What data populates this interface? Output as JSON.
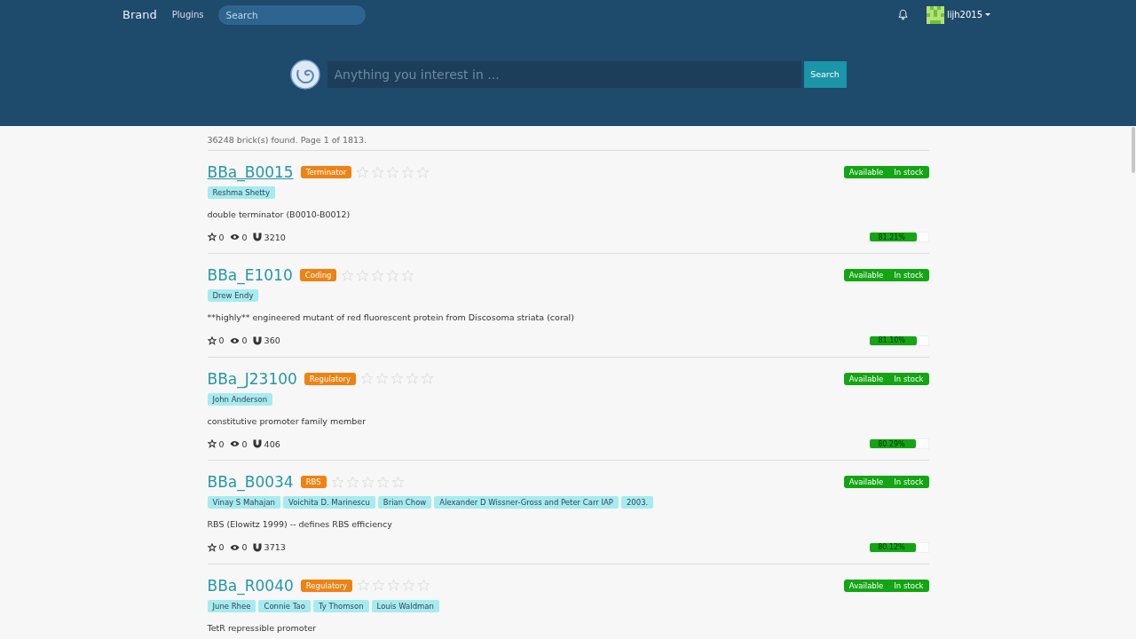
{
  "navbar": {
    "brand": "Brand",
    "links": [
      "Plugins"
    ],
    "search": {
      "placeholder": "Search"
    },
    "user": {
      "name": "lijh2015"
    }
  },
  "hero": {
    "search": {
      "placeholder": "Anything you interest in ..."
    },
    "button": "Search"
  },
  "summary": "36248 brick(s) found. Page 1 of 1813.",
  "bricks": [
    {
      "name": "BBa_B0015",
      "hovered": true,
      "type": "Terminator",
      "stars": 0,
      "authors": [
        "Reshma Shetty"
      ],
      "description": "double terminator (B0010-B0012)",
      "favorites": "0",
      "views": "0",
      "uses": "3210",
      "status": "Available",
      "stock": "In stock",
      "level": 0.81,
      "percent": "81.21%"
    },
    {
      "name": "BBa_E1010",
      "hovered": false,
      "type": "Coding",
      "stars": 0,
      "authors": [
        "Drew Endy"
      ],
      "description": "**highly** engineered mutant of red fluorescent protein from Discosoma striata (coral)",
      "favorites": "0",
      "views": "0",
      "uses": "360",
      "status": "Available",
      "stock": "In stock",
      "level": 0.81,
      "percent": "81.10%"
    },
    {
      "name": "BBa_J23100",
      "hovered": false,
      "type": "Regulatory",
      "stars": 0,
      "authors": [
        "John Anderson"
      ],
      "description": "constitutive promoter family member",
      "favorites": "0",
      "views": "0",
      "uses": "406",
      "status": "Available",
      "stock": "In stock",
      "level": 0.8,
      "percent": "80.29%"
    },
    {
      "name": "BBa_B0034",
      "hovered": false,
      "type": "RBS",
      "stars": 0,
      "authors": [
        "Vinay S Mahajan",
        "Voichita D. Marinescu",
        "Brian Chow",
        "Alexander D Wissner-Gross and Peter Carr IAP",
        "2003."
      ],
      "description": "RBS (Elowitz 1999) -- defines RBS efficiency",
      "favorites": "0",
      "views": "0",
      "uses": "3713",
      "status": "Available",
      "stock": "In stock",
      "level": 0.8,
      "percent": "80.12%"
    },
    {
      "name": "BBa_R0040",
      "hovered": false,
      "type": "Regulatory",
      "stars": 0,
      "authors": [
        "June Rhee",
        "Connie Tao",
        "Ty Thomson",
        "Louis Waldman"
      ],
      "description": "TetR repressible promoter",
      "status": "Available",
      "stock": "In stock"
    }
  ]
}
